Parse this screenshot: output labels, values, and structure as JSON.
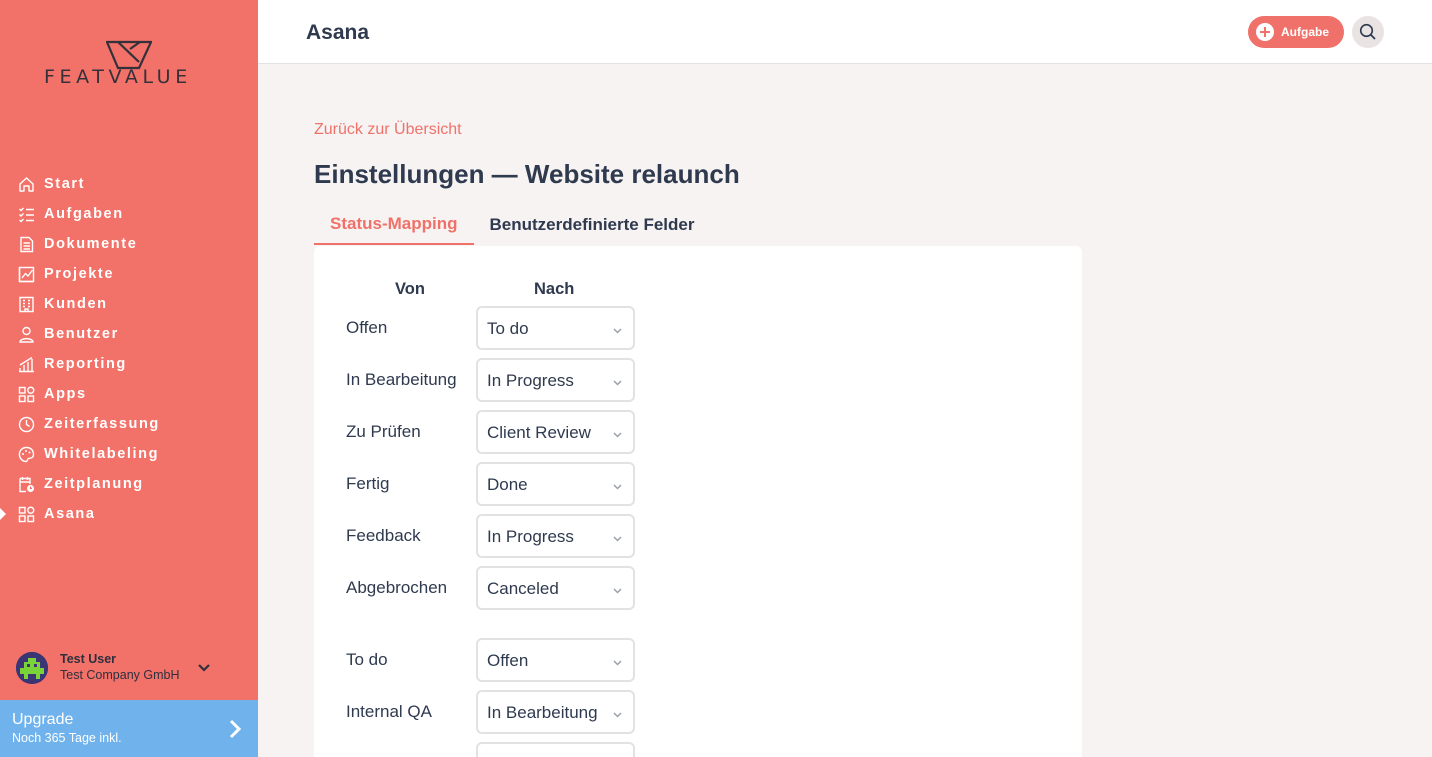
{
  "sidebar": {
    "logo_text": "FEATVALUE",
    "items": [
      {
        "label": "Start",
        "icon": "home-icon"
      },
      {
        "label": "Aufgaben",
        "icon": "tasks-icon"
      },
      {
        "label": "Dokumente",
        "icon": "document-icon"
      },
      {
        "label": "Projekte",
        "icon": "chart-icon"
      },
      {
        "label": "Kunden",
        "icon": "building-icon"
      },
      {
        "label": "Benutzer",
        "icon": "user-icon"
      },
      {
        "label": "Reporting",
        "icon": "bar-chart-icon"
      },
      {
        "label": "Apps",
        "icon": "apps-icon"
      },
      {
        "label": "Zeiterfassung",
        "icon": "clock-icon"
      },
      {
        "label": "Whitelabeling",
        "icon": "palette-icon"
      },
      {
        "label": "Zeitplanung",
        "icon": "calendar-clock-icon"
      },
      {
        "label": "Asana",
        "icon": "apps-icon",
        "active": true
      }
    ],
    "user": {
      "name": "Test User",
      "company": "Test Company GmbH"
    },
    "upgrade": {
      "title": "Upgrade",
      "subtitle": "Noch 365 Tage inkl."
    }
  },
  "header": {
    "title": "Asana",
    "task_button": "Aufgabe"
  },
  "main": {
    "back_link": "Zurück zur Übersicht",
    "title": "Einstellungen — Website relaunch",
    "tabs": [
      {
        "label": "Status-Mapping",
        "active": true
      },
      {
        "label": "Benutzerdefinierte Felder",
        "active": false
      }
    ],
    "columns": {
      "from": "Von",
      "to": "Nach"
    },
    "mappings": [
      {
        "from": "Offen",
        "to": "To do"
      },
      {
        "from": "In Bearbeitung",
        "to": "In Progress"
      },
      {
        "from": "Zu Prüfen",
        "to": "Client Review"
      },
      {
        "from": "Fertig",
        "to": "Done"
      },
      {
        "from": "Feedback",
        "to": "In Progress"
      },
      {
        "from": "Abgebrochen",
        "to": "Canceled"
      }
    ],
    "reverse_mappings": [
      {
        "from": "To do",
        "to": "Offen"
      },
      {
        "from": "Internal QA",
        "to": "In Bearbeitung"
      },
      {
        "from": "",
        "to": ""
      }
    ]
  },
  "colors": {
    "sidebar": "#f27168",
    "accent": "#f0716a",
    "upgrade": "#6fb2ec",
    "text": "#2f3a4f"
  }
}
